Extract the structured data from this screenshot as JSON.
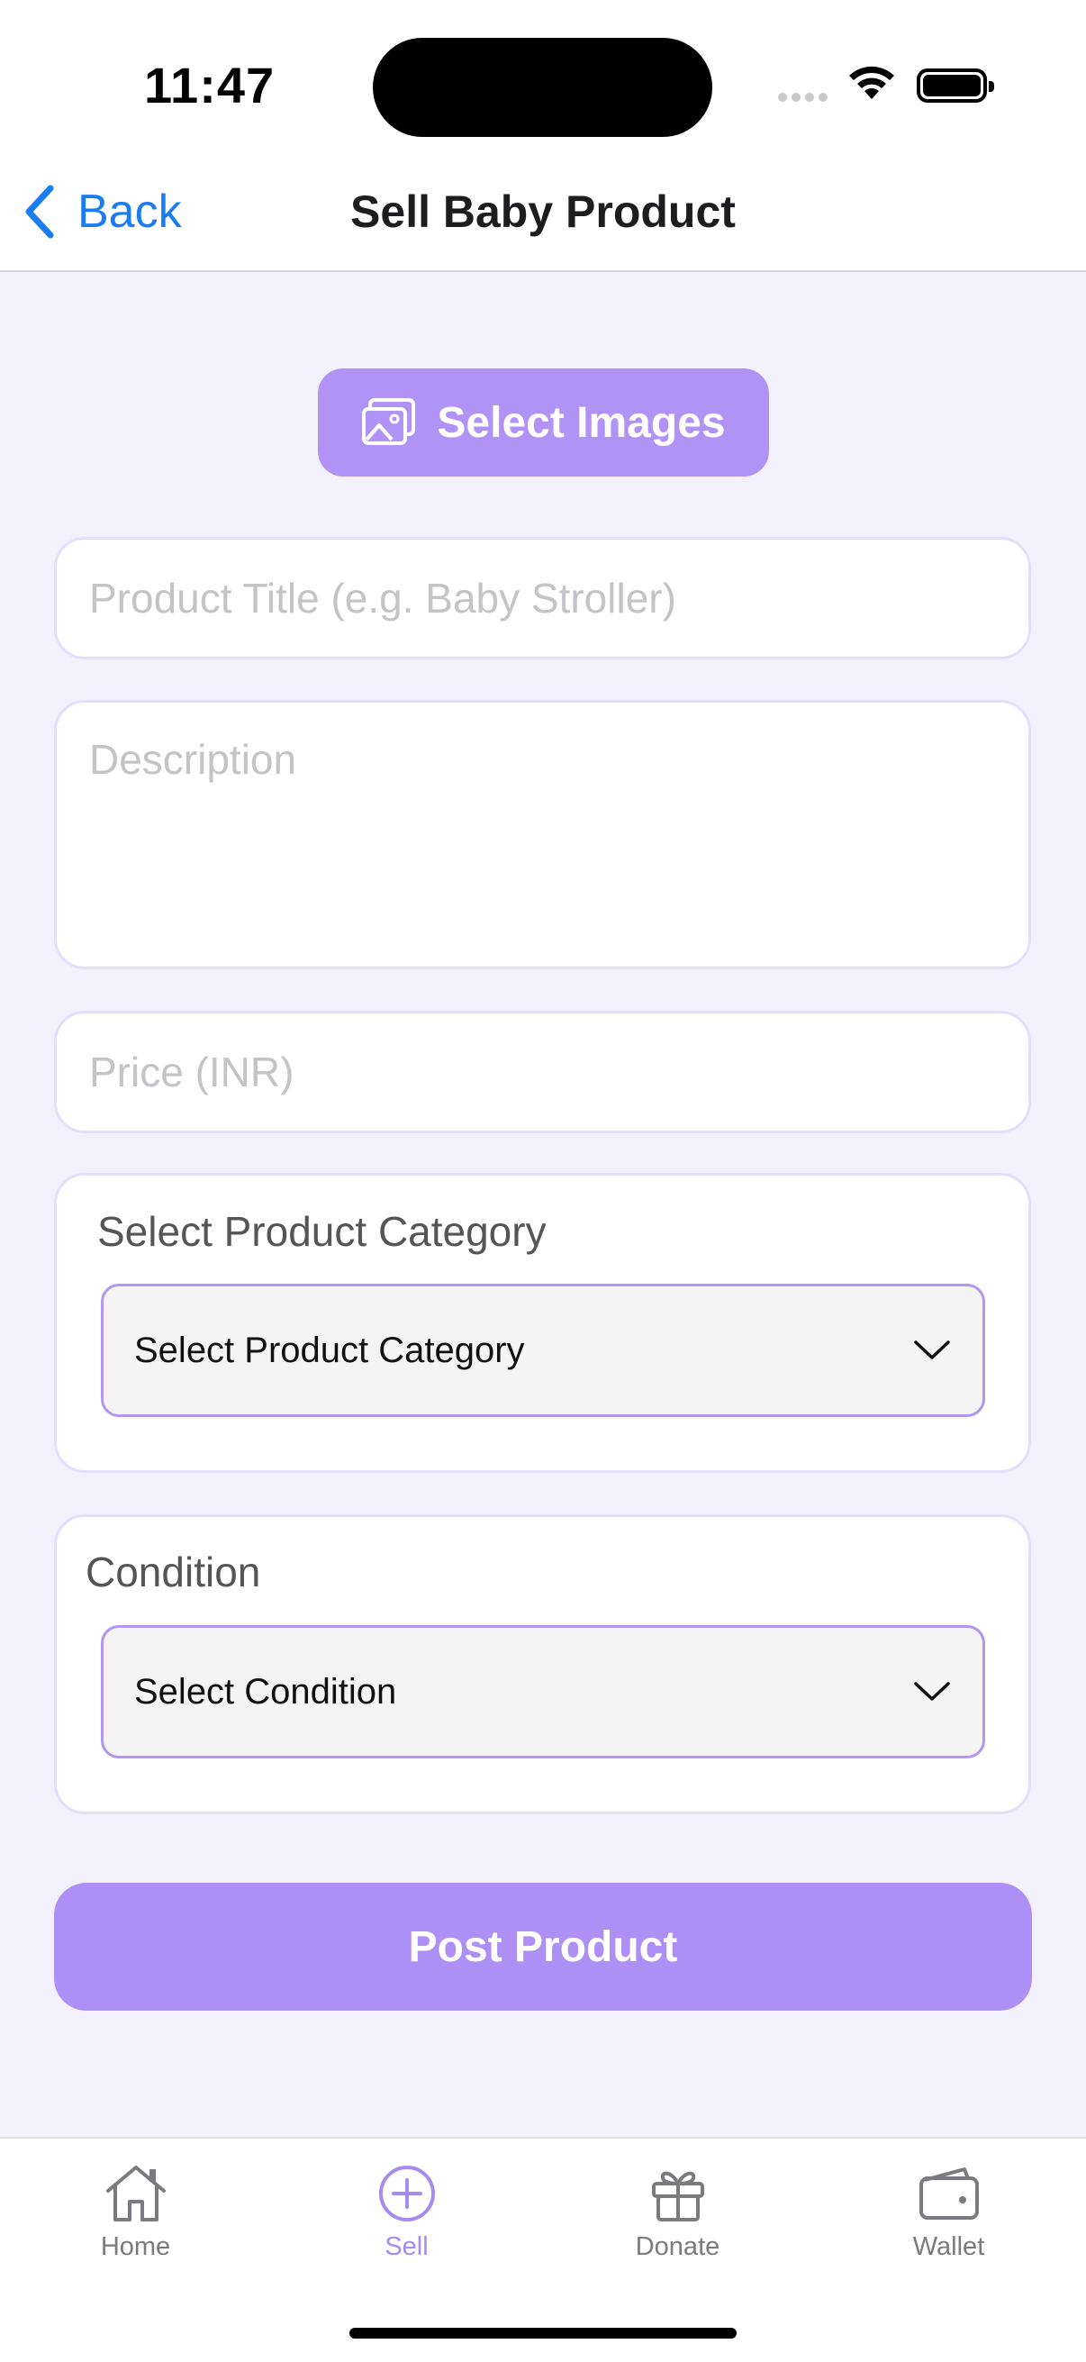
{
  "status_bar": {
    "time": "11:47"
  },
  "nav": {
    "back_label": "Back",
    "title": "Sell Baby Product"
  },
  "select_images": {
    "label": "Select Images"
  },
  "form": {
    "title_placeholder": "Product Title (e.g. Baby Stroller)",
    "title_value": "",
    "description_placeholder": "Description",
    "description_value": "",
    "price_placeholder": "Price (INR)",
    "price_value": ""
  },
  "category": {
    "label": "Select Product Category",
    "selected": "Select Product Category"
  },
  "condition": {
    "label": "Condition",
    "selected": "Select Condition"
  },
  "post_button": {
    "label": "Post Product"
  },
  "tabs": [
    {
      "label": "Home",
      "icon": "home-icon",
      "active": false
    },
    {
      "label": "Sell",
      "icon": "plus-circle-icon",
      "active": true
    },
    {
      "label": "Donate",
      "icon": "gift-icon",
      "active": false
    },
    {
      "label": "Wallet",
      "icon": "wallet-icon",
      "active": false
    }
  ],
  "colors": {
    "accent": "#b193f5",
    "background": "#f3f1fd",
    "link": "#1a7cf2",
    "active_tab": "#a68bf0"
  }
}
